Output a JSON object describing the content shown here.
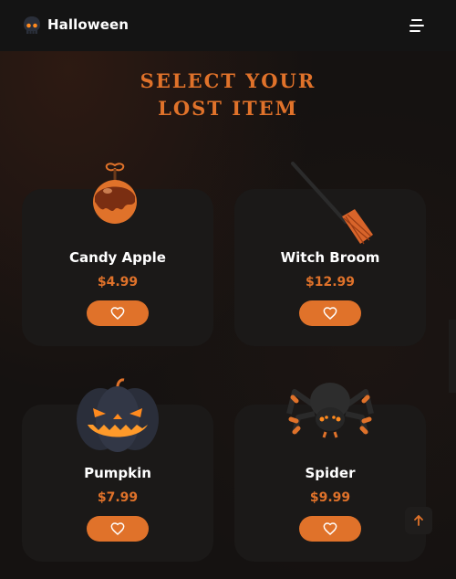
{
  "header": {
    "brand": "Halloween",
    "logo_icon": "skull-icon",
    "menu_icon": "menu-icon"
  },
  "title": {
    "line1": "Select your",
    "line2": "lost item"
  },
  "products": [
    {
      "name": "Candy Apple",
      "price": "$4.99",
      "image": "candy-apple",
      "action_icon": "heart-icon"
    },
    {
      "name": "Witch Broom",
      "price": "$12.99",
      "image": "witch-broom",
      "action_icon": "heart-icon"
    },
    {
      "name": "Pumpkin",
      "price": "$7.99",
      "image": "jack-o-lantern",
      "action_icon": "heart-icon"
    },
    {
      "name": "Spider",
      "price": "$9.99",
      "image": "spider",
      "action_icon": "heart-icon"
    }
  ],
  "scroll_top_icon": "arrow-up-icon",
  "colors": {
    "accent": "#e0722a",
    "background": "#151211",
    "card": "#1b1918",
    "header": "#141414"
  }
}
